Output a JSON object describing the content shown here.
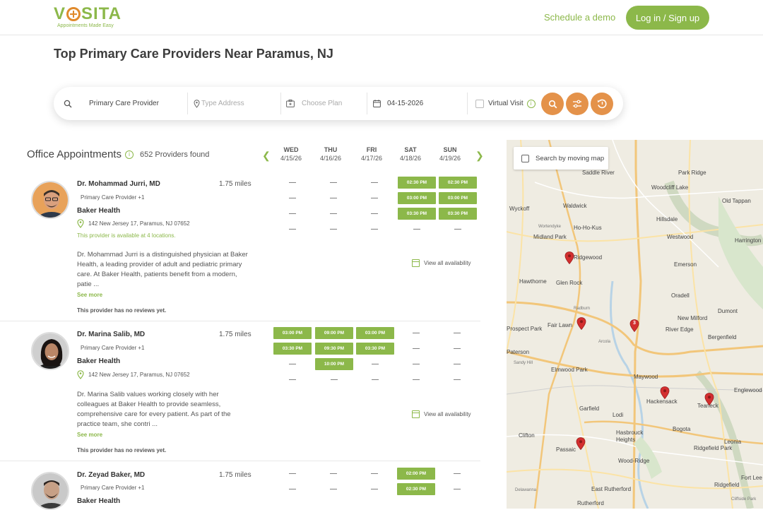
{
  "header": {
    "logo": "VOSITA",
    "logo_tagline": "Appointments Made Easy",
    "demo_link": "Schedule a demo",
    "login_button": "Log in / Sign up"
  },
  "page_title": "Top Primary Care Providers Near Paramus, NJ",
  "search": {
    "specialty_value": "Primary Care Provider",
    "address_placeholder": "Type Address",
    "plan_placeholder": "Choose Plan",
    "date_value": "04-15-2026",
    "virtual_label": "Virtual Visit"
  },
  "list": {
    "title": "Office Appointments",
    "count": "652 Providers found",
    "days": [
      {
        "name": "WED",
        "date": "4/15/26"
      },
      {
        "name": "THU",
        "date": "4/16/26"
      },
      {
        "name": "FRI",
        "date": "4/17/26"
      },
      {
        "name": "SAT",
        "date": "4/18/26"
      },
      {
        "name": "SUN",
        "date": "4/19/26"
      }
    ]
  },
  "providers": [
    {
      "name": "Dr. Mohammad Jurri, MD",
      "specialty": "Primary Care Provider +1",
      "org": "Baker Health",
      "address": "142 New Jersey 17, Paramus, NJ 07652",
      "availability": "This provider is available at 4 locations.",
      "distance": "1.75 miles",
      "description": "Dr. Mohammad Jurri is a distinguished physician at Baker Health, a leading provider of adult and pediatric primary care. At Baker Health, patients benefit from a modern, patie ...",
      "see_more": "See more",
      "reviews": "This provider has no reviews yet.",
      "view_all": "View all availability",
      "slots": {
        "sat": [
          "02:30 PM",
          "03:00 PM",
          "03:30 PM"
        ],
        "sun": [
          "02:30 PM",
          "03:00 PM",
          "03:30 PM"
        ]
      }
    },
    {
      "name": "Dr. Marina Salib, MD",
      "specialty": "Primary Care Provider +1",
      "org": "Baker Health",
      "address": "142 New Jersey 17, Paramus, NJ 07652",
      "distance": "1.75 miles",
      "description": "Dr. Marina Salib values working closely with her colleagues at Baker Health to provide seamless, comprehensive care for every patient. As part of the practice team, she contri ...",
      "see_more": "See more",
      "reviews": "This provider has no reviews yet.",
      "view_all": "View all availability",
      "slots": {
        "wed": [
          "03:00 PM",
          "03:30 PM"
        ],
        "thu": [
          "09:00 PM",
          "09:30 PM",
          "10:00 PM"
        ],
        "fri": [
          "03:00 PM",
          "03:30 PM"
        ]
      }
    },
    {
      "name": "Dr. Zeyad Baker, MD",
      "specialty": "Primary Care Provider +1",
      "org": "Baker Health",
      "distance": "1.75 miles",
      "slots": {
        "sat": [
          "02:00 PM",
          "02:30 PM"
        ]
      }
    }
  ],
  "dash": "—",
  "map": {
    "search_by_moving": "Search by moving map",
    "labels": [
      "Saddle River",
      "Park Ridge",
      "Woodcliff Lake",
      "Old Tappan",
      "Waldwick",
      "Ho-Ho-Kus",
      "Hillsdale",
      "Midland Park",
      "Westwood",
      "Harrington Park",
      "Ridgewood",
      "Emerson",
      "Hawthorne",
      "Glen Rock",
      "Oradell",
      "Dumont",
      "Fair Lawn",
      "New Milford",
      "River Edge",
      "Bergenfield",
      "Elmwood Park",
      "Maywood",
      "Hackensack",
      "Teaneck",
      "Englewood",
      "Garfield",
      "Lodi",
      "Hasbrouck Heights",
      "Bogota",
      "Clifton",
      "Passaic",
      "Wood-Ridge",
      "Ridgefield Park",
      "Leonia",
      "East Rutherford",
      "Ridgefield",
      "Fort Lee",
      "Rutherford",
      "Wyckoff",
      "Paterson",
      "Prospect Park",
      "Arcola",
      "Cliffside Park",
      "Radburn",
      "Wortendyke",
      "Sandy Hill",
      "Delawanna"
    ],
    "cluster_count": "3"
  },
  "colors": {
    "brand_green": "#8cb84a",
    "accent_orange": "#e4924a",
    "pin_red": "#d32f2f"
  }
}
